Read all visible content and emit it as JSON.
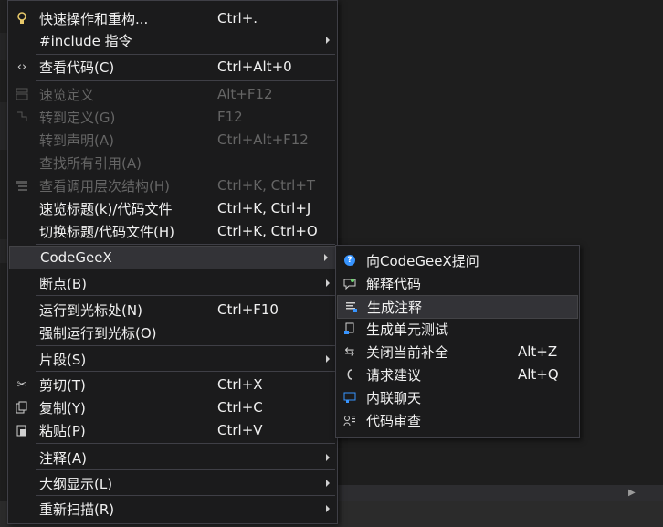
{
  "main_menu": {
    "items": [
      {
        "label": "快速操作和重构...",
        "shortcut": "Ctrl+.",
        "icon": "lightbulb-icon",
        "disabled": false
      },
      {
        "label": "#include 指令",
        "shortcut": "",
        "submenu": true,
        "disabled": false
      },
      {
        "label": "查看代码(C)",
        "shortcut": "Ctrl+Alt+0",
        "icon": "code-brackets-icon",
        "disabled": false
      },
      {
        "label": "速览定义",
        "shortcut": "Alt+F12",
        "icon": "peek-definition-icon",
        "disabled": true
      },
      {
        "label": "转到定义(G)",
        "shortcut": "F12",
        "icon": "goto-definition-icon",
        "disabled": true
      },
      {
        "label": "转到声明(A)",
        "shortcut": "Ctrl+Alt+F12",
        "disabled": true
      },
      {
        "label": "查找所有引用(A)",
        "shortcut": "",
        "disabled": true
      },
      {
        "label": "查看调用层次结构(H)",
        "shortcut": "Ctrl+K, Ctrl+T",
        "icon": "call-hierarchy-icon",
        "disabled": true
      },
      {
        "label": "速览标题(k)/代码文件",
        "shortcut": "Ctrl+K, Ctrl+J",
        "disabled": false
      },
      {
        "label": "切换标题/代码文件(H)",
        "shortcut": "Ctrl+K, Ctrl+O",
        "disabled": false
      },
      {
        "label": "CodeGeeX",
        "shortcut": "",
        "submenu": true,
        "highlight": true
      },
      {
        "label": "断点(B)",
        "shortcut": "",
        "submenu": true
      },
      {
        "label": "运行到光标处(N)",
        "shortcut": "Ctrl+F10"
      },
      {
        "label": "强制运行到光标(O)",
        "shortcut": ""
      },
      {
        "label": "片段(S)",
        "shortcut": "",
        "submenu": true
      },
      {
        "label": "剪切(T)",
        "shortcut": "Ctrl+X",
        "icon": "scissors-icon"
      },
      {
        "label": "复制(Y)",
        "shortcut": "Ctrl+C",
        "icon": "copy-icon"
      },
      {
        "label": "粘贴(P)",
        "shortcut": "Ctrl+V",
        "icon": "paste-icon"
      },
      {
        "label": "注释(A)",
        "shortcut": "",
        "submenu": true
      },
      {
        "label": "大纲显示(L)",
        "shortcut": "",
        "submenu": true
      },
      {
        "label": "重新扫描(R)",
        "shortcut": "",
        "submenu": true
      }
    ]
  },
  "sub_menu": {
    "items": [
      {
        "label": "向CodeGeeX提问",
        "shortcut": "",
        "icon": "help-circle-icon"
      },
      {
        "label": "解释代码",
        "shortcut": "",
        "icon": "explain-code-icon"
      },
      {
        "label": "生成注释",
        "shortcut": "",
        "icon": "generate-comment-icon",
        "highlight": true
      },
      {
        "label": "生成单元测试",
        "shortcut": "",
        "icon": "unit-test-icon"
      },
      {
        "label": "关闭当前补全",
        "shortcut": "Alt+Z",
        "icon": "swap-arrows-icon"
      },
      {
        "label": "请求建议",
        "shortcut": "Alt+Q",
        "icon": "suggest-icon"
      },
      {
        "label": "内联聊天",
        "shortcut": "",
        "icon": "inline-chat-icon"
      },
      {
        "label": "代码审查",
        "shortcut": "",
        "icon": "code-review-icon"
      }
    ]
  },
  "colors": {
    "menu_bg": "#1b1b1c",
    "highlight_bg": "#333337",
    "disabled_text": "#656565",
    "accent": "#3794ff"
  }
}
